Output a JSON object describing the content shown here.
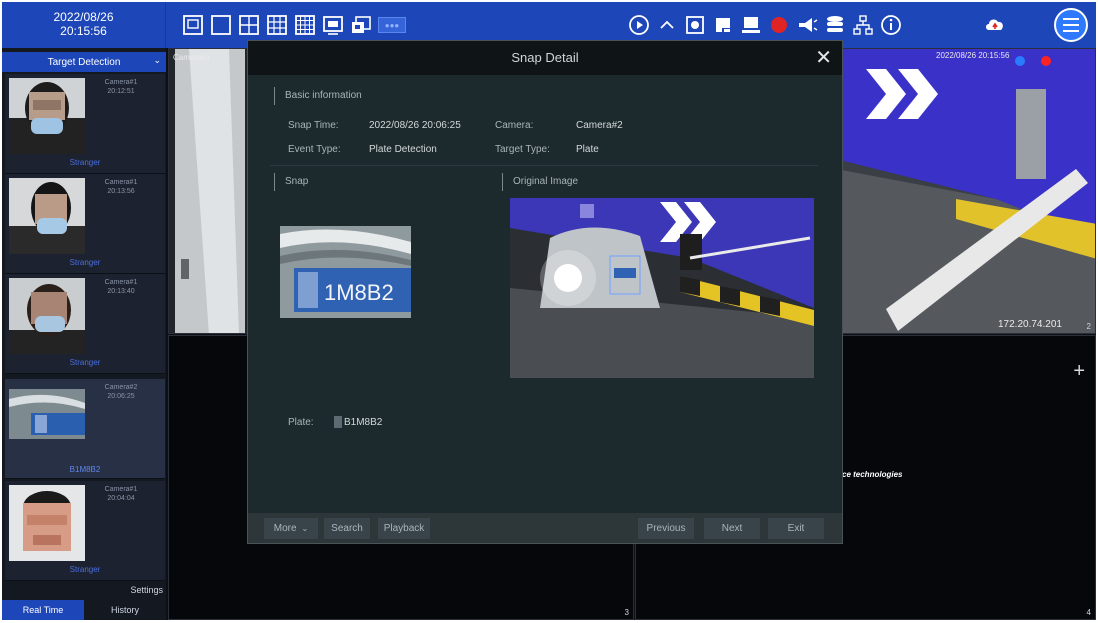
{
  "clock": {
    "date": "2022/08/26",
    "time": "20:15:56"
  },
  "left_panel": {
    "target_select": "Target Detection",
    "cards": [
      {
        "camera": "Camera#1",
        "time": "20:12:51",
        "label": "Stranger"
      },
      {
        "camera": "Camera#1",
        "time": "20:13:56",
        "label": "Stranger"
      },
      {
        "camera": "Camera#1",
        "time": "20:13:40",
        "label": "Stranger"
      },
      {
        "camera": "Camera#2",
        "time": "20:06:25",
        "label": "B1M8B2"
      },
      {
        "camera": "Camera#1",
        "time": "20:04:04",
        "label": "Stranger"
      }
    ],
    "settings": "Settings",
    "tab_realtime": "Real Time",
    "tab_history": "History"
  },
  "cameras": {
    "tile1_label": "Camera#1",
    "tile2_timestamp": "2022/08/26 20:15:56",
    "tile2_ip": "172.20.74.201",
    "tile2_num": "2",
    "tile3_num": "3",
    "tile4_num": "4",
    "tile4_plus": "+",
    "tile4_logo": "ce technologies"
  },
  "modal": {
    "title": "Snap Detail",
    "close": "✕",
    "basic_info": "Basic information",
    "snap_time_label": "Snap Time:",
    "snap_time_value": "2022/08/26 20:06:25",
    "camera_label": "Camera:",
    "camera_value": "Camera#2",
    "event_type_label": "Event Type:",
    "event_type_value": "Plate Detection",
    "target_type_label": "Target Type:",
    "target_type_value": "Plate",
    "snap_section": "Snap",
    "original_section": "Original Image",
    "plate_crop_text": "1M8B2",
    "plate_label": "Plate:",
    "plate_value": "B1M8B2",
    "more_btn": "More",
    "search_btn": "Search",
    "playback_btn": "Playback",
    "previous_btn": "Previous",
    "next_btn": "Next",
    "exit_btn": "Exit"
  },
  "colors": {
    "toolbar": "#1d46b8",
    "accent": "#2f79ff",
    "modal_bg": "#1d2a2d"
  }
}
